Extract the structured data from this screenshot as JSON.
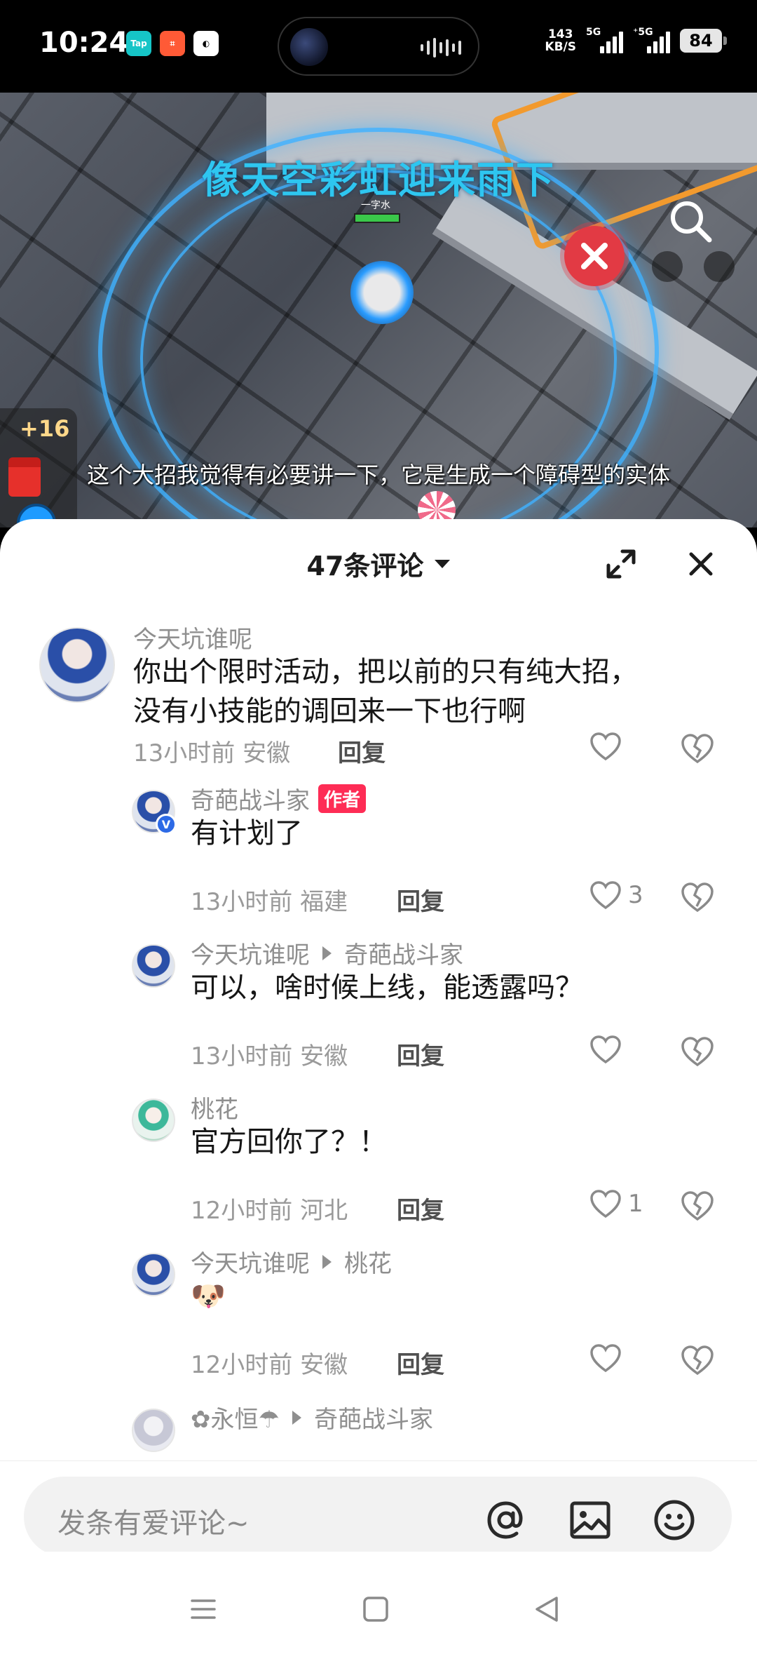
{
  "status_bar": {
    "time": "10:24",
    "apps": [
      "Tap",
      "⌗",
      "◐"
    ],
    "net_speed_value": "143",
    "net_speed_unit": "KB/S",
    "sim1": "5G",
    "sim2": "⁺5G",
    "battery": "84"
  },
  "video": {
    "title": "像天空彩虹迎来雨下",
    "subtitle": "这个大招我觉得有必要讲一下，它是生成一个障碍型的实体",
    "bonus": "+16",
    "hero_name": "一字水"
  },
  "sheet": {
    "comment_count": "47条评论"
  },
  "comments": [
    {
      "user": "今天坑谁呢",
      "text_line1": "你出个限时活动，把以前的只有纯大招，",
      "text_line2": "没有小技能的调回来一下也行啊",
      "meta": "13小时前 安徽",
      "reply": "回复",
      "likes": ""
    },
    {
      "user": "奇葩战斗家",
      "badge": "作者",
      "text": "有计划了",
      "meta": "13小时前 福建",
      "reply": "回复",
      "likes": "3"
    },
    {
      "user": "今天坑谁呢",
      "reply_to": "奇葩战斗家",
      "text": "可以，啥时候上线，能透露吗？",
      "meta": "13小时前 安徽",
      "reply": "回复",
      "likes": ""
    },
    {
      "user": "桃花",
      "text": "官方回你了？！",
      "meta": "12小时前 河北",
      "reply": "回复",
      "likes": "1"
    },
    {
      "user": "今天坑谁呢",
      "reply_to": "桃花",
      "text": "🐶",
      "meta": "12小时前 安徽",
      "reply": "回复",
      "likes": ""
    },
    {
      "user": "✿永恒☂",
      "reply_to": "奇葩战斗家"
    }
  ],
  "input": {
    "placeholder": "发条有爱评论~"
  },
  "icons": {
    "at": "at-icon",
    "image": "image-icon",
    "emoji": "emoji-icon",
    "heart": "heart-icon",
    "dislike": "broken-heart-icon"
  },
  "colors": {
    "accent_red": "#fe2c55",
    "verify_blue": "#2d6ae6",
    "title_cyan": "#2ec6f0"
  }
}
